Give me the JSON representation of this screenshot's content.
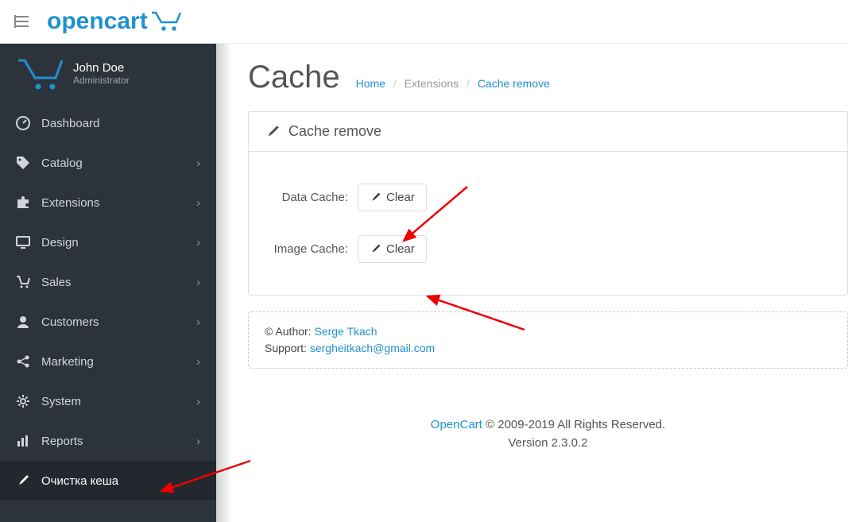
{
  "header": {
    "logo_bold": "open",
    "logo_light": "cart"
  },
  "profile": {
    "name": "John Doe",
    "role": "Administrator"
  },
  "sidebar": {
    "items": [
      {
        "icon": "dashboard",
        "label": "Dashboard",
        "expand": false
      },
      {
        "icon": "tag",
        "label": "Catalog",
        "expand": true
      },
      {
        "icon": "puzzle",
        "label": "Extensions",
        "expand": true
      },
      {
        "icon": "desktop",
        "label": "Design",
        "expand": true
      },
      {
        "icon": "cart",
        "label": "Sales",
        "expand": true
      },
      {
        "icon": "user",
        "label": "Customers",
        "expand": true
      },
      {
        "icon": "share",
        "label": "Marketing",
        "expand": true
      },
      {
        "icon": "gear",
        "label": "System",
        "expand": true
      },
      {
        "icon": "chart",
        "label": "Reports",
        "expand": true
      },
      {
        "icon": "paintbrush",
        "label": "Очистка кеша",
        "expand": false,
        "active": true
      }
    ]
  },
  "page": {
    "title": "Cache",
    "breadcrumb": {
      "home": "Home",
      "extensions": "Extensions",
      "current": "Cache remove"
    },
    "panel_title": "Cache remove",
    "rows": [
      {
        "label": "Data Cache:",
        "button": "Clear"
      },
      {
        "label": "Image Cache:",
        "button": "Clear"
      }
    ],
    "author_prefix": "© Author: ",
    "author_name": "Serge Tkach",
    "support_prefix": "Support: ",
    "support_email": "sergheitkach@gmail.com"
  },
  "footer": {
    "link": "OpenCart",
    "copy": " © 2009-2019 All Rights Reserved.",
    "version": "Version 2.3.0.2"
  }
}
